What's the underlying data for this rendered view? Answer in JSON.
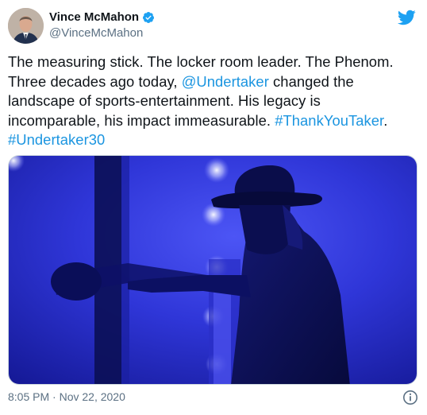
{
  "author": {
    "name": "Vince McMahon",
    "handle": "@VinceMcMahon",
    "verified_icon": "verified-badge-icon",
    "avatar_icon": "avatar"
  },
  "brand": {
    "icon": "twitter-bird-icon",
    "color": "#1da1f2"
  },
  "tweet": {
    "line1": "The measuring stick. The locker room leader. The Phenom.",
    "line2_pre": "Three decades ago today, ",
    "line2_mention": "@Undertaker",
    "line2_post": " changed the",
    "line3": "landscape of sports-entertainment. His legacy is",
    "line4_pre": "incomparable, his impact immeasurable. ",
    "line4_hashtag": "#ThankYouTaker",
    "line4_post": ".",
    "line5_hashtag": "#Undertaker30"
  },
  "footer": {
    "timestamp": "8:05 PM · Nov 22, 2020"
  },
  "colors": {
    "link": "#1b95e0",
    "secondary_text": "#5b7083",
    "photo_blue": "#2b2fd6"
  }
}
